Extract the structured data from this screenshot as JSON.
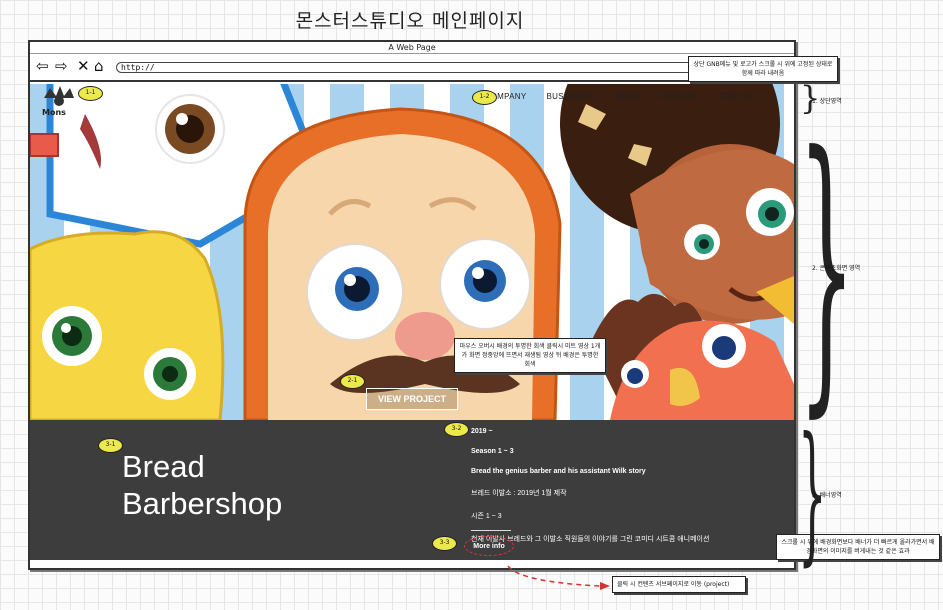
{
  "title": "몬스터스튜디오 메인페이지",
  "browser": {
    "window_title": "A Web Page",
    "url": "http://",
    "nav_icons": [
      "arrow-left-icon",
      "arrow-right-icon",
      "close-icon",
      "home-icon"
    ]
  },
  "header": {
    "gnb": [
      "COMPANY",
      "BUSSINESS",
      "NEWS",
      "RECRUIT",
      "CONTACT"
    ]
  },
  "hero": {
    "button_label": "VIEW PROJECT"
  },
  "banner": {
    "title_line1": "Bread",
    "title_line2": "Barbershop",
    "info": [
      "2019 ~",
      "Season 1 ~ 3",
      "Bread the genius barber and his assistant Wilk story",
      "브레드 이발소 : 2019년 1월 제작",
      "시즌 1 ~ 3",
      "천재 이발사 브레드와 그 이발소 직원들의 이야기를 그린 코미디 시트콤 애니메이션"
    ],
    "more_label": "More info"
  },
  "markers": {
    "m1_1": "1-1",
    "m1_2": "1-2",
    "m2_1": "2-1",
    "m3_1": "3-1",
    "m3_2": "3-2",
    "m3_3": "3-3"
  },
  "callouts": {
    "top": "상단 GNB메뉴 및 로고가 스크롤 시 위에 고정된 상태로 함께 따라 내려옴",
    "middle": "마우스 오버시 배경의 투명한 회색 클릭시 미트 영상 1개가 화면 정중앙에 뜨면서 재생됨 영상 뒤 배경은 투명한 회색",
    "bottom_right": "스크롤 시 위에 배경화면보다 배너가 더 빠르게 올라가면서 배경화면의 이미지를 버게내는 것 같은 효과",
    "bottom": "클릭 시 컨텐츠 서브페이지로 이동 (project)"
  },
  "side_labels": {
    "s1": "1. 상단영역",
    "s2": "2. 콘텐츠화면 영역",
    "s3": "3. 배너영역"
  },
  "colors": {
    "banner_bg": "#3d3d3d",
    "marker": "#ece94a",
    "stripe_blue": "#a9d2ee",
    "dash_red": "#d33333"
  }
}
